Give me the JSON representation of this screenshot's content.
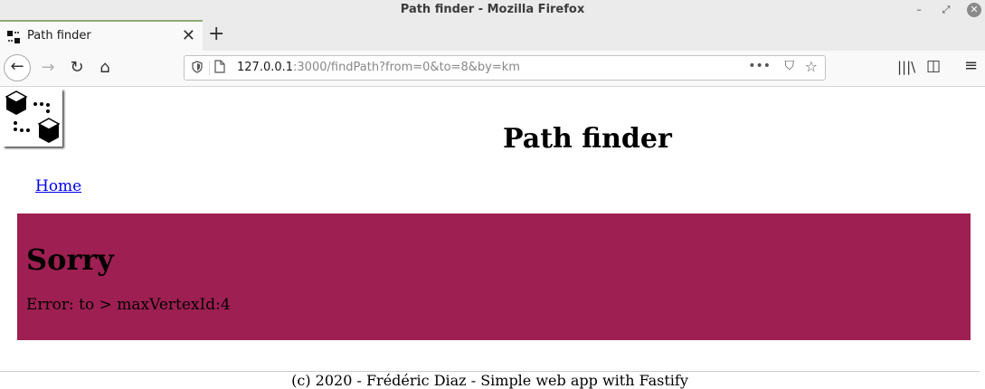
{
  "window": {
    "title": "Path finder - Mozilla Firefox",
    "minimize_glyph": "–",
    "restore_glyph": "⤢",
    "close_glyph": "✕"
  },
  "tabs": [
    {
      "label": "Path finder",
      "close_glyph": "✕",
      "icon": "cubes-favicon-icon"
    }
  ],
  "new_tab_glyph": "+",
  "toolbar": {
    "back_glyph": "←",
    "forward_glyph": "→",
    "reload_glyph": "↻",
    "home_glyph": "⌂",
    "url_host": "127.0.0.1",
    "url_rest": ":3000/findPath?from=0&to=8&by=km",
    "page_actions_glyph": "•••",
    "pocket_glyph": "⛉",
    "bookmark_glyph": "☆",
    "library_glyph": "|||\\",
    "sidebar_glyph": "◫",
    "menu_glyph": "≡"
  },
  "page": {
    "title": "Path finder",
    "nav": {
      "home_label": "Home"
    },
    "error": {
      "heading": "Sorry",
      "message": "Error: to > maxVertexId:4",
      "background": "#9e1f52"
    },
    "footer": "(c) 2020 - Frédéric Diaz - Simple web app with Fastify"
  }
}
